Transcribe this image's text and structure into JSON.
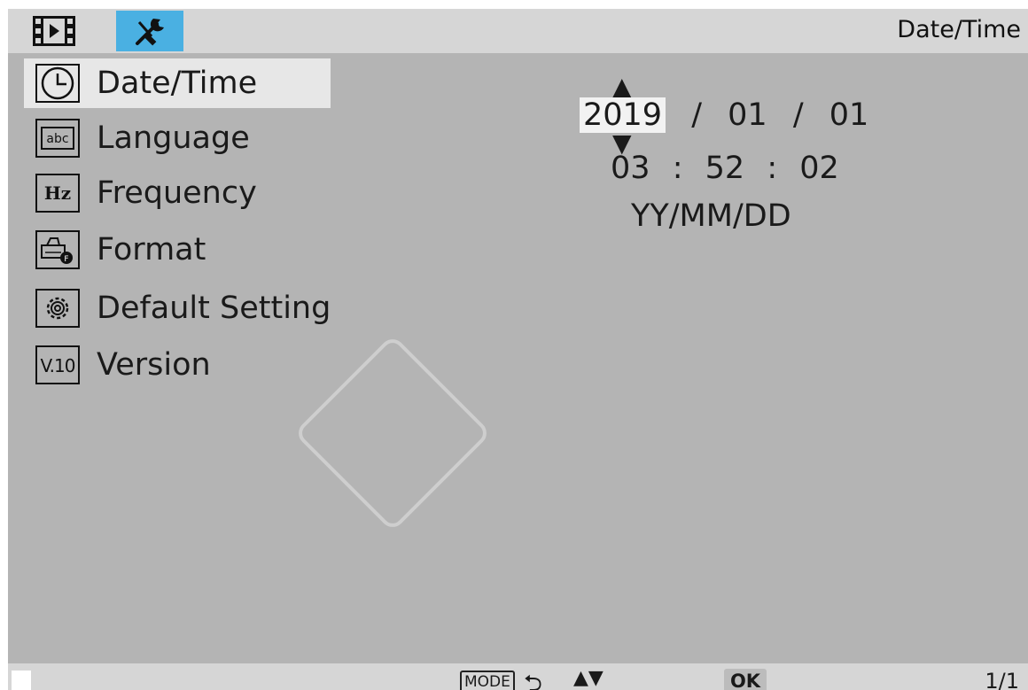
{
  "header": {
    "title": "Date/Time",
    "tabs": [
      {
        "name": "playback",
        "icon": "film-play-icon"
      },
      {
        "name": "settings",
        "icon": "wrench-screwdriver-icon",
        "active": true
      }
    ]
  },
  "menu": {
    "items": [
      {
        "label": "Date/Time",
        "icon": "clock-icon",
        "selected": true
      },
      {
        "label": "Language",
        "icon": "abc-icon"
      },
      {
        "label": "Frequency",
        "icon": "hz-icon"
      },
      {
        "label": "Format",
        "icon": "format-icon"
      },
      {
        "label": "Default Setting",
        "icon": "gear-icon"
      },
      {
        "label": "Version",
        "icon": "version-icon"
      }
    ]
  },
  "datetime": {
    "year": "2019",
    "date_sep": "/",
    "month": "01",
    "day": "01",
    "hour": "03",
    "time_sep": ":",
    "minute": "52",
    "second": "02",
    "format": "YY/MM/DD"
  },
  "icons": {
    "hz_text": "Hz",
    "abc_text": "abc",
    "version_text": "V.10"
  },
  "footer": {
    "mode_label": "MODE",
    "ok_label": "OK",
    "page": "1/1"
  },
  "colors": {
    "screen_bg": "#b4b4b4",
    "bar_bg": "#d6d6d6",
    "active_tab": "#4ab0e2",
    "selected_item": "#e7e7e7"
  }
}
